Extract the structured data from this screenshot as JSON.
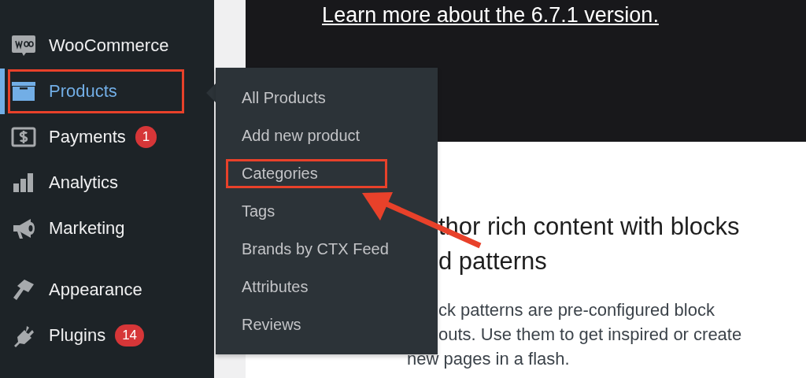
{
  "sidebar": {
    "groups": [
      [
        {
          "label": "WooCommerce",
          "selected": false,
          "highlighted": false
        },
        {
          "label": "Products",
          "selected": true,
          "highlighted": true
        },
        {
          "label": "Payments",
          "selected": false,
          "highlighted": false,
          "badge": "1"
        },
        {
          "label": "Analytics",
          "selected": false,
          "highlighted": false
        },
        {
          "label": "Marketing",
          "selected": false,
          "highlighted": false
        }
      ],
      [
        {
          "label": "Appearance",
          "selected": false,
          "highlighted": false
        },
        {
          "label": "Plugins",
          "selected": false,
          "highlighted": false,
          "badge": "14"
        }
      ]
    ]
  },
  "flyout": {
    "items": [
      {
        "label": "All Products",
        "highlighted": false
      },
      {
        "label": "Add new product",
        "highlighted": false
      },
      {
        "label": "Categories",
        "highlighted": true
      },
      {
        "label": "Tags",
        "highlighted": false
      },
      {
        "label": "Brands by CTX Feed",
        "highlighted": false
      },
      {
        "label": "Attributes",
        "highlighted": false
      },
      {
        "label": "Reviews",
        "highlighted": false
      }
    ]
  },
  "banner": {
    "link": "Learn more about the 6.7.1 version."
  },
  "content": {
    "heading_lines": [
      "thor rich content with blocks",
      "d patterns"
    ],
    "paragraph_lines": [
      "ck patterns are pre-configured block",
      "outs. Use them to get inspired or create",
      "new pages in a flash."
    ]
  }
}
